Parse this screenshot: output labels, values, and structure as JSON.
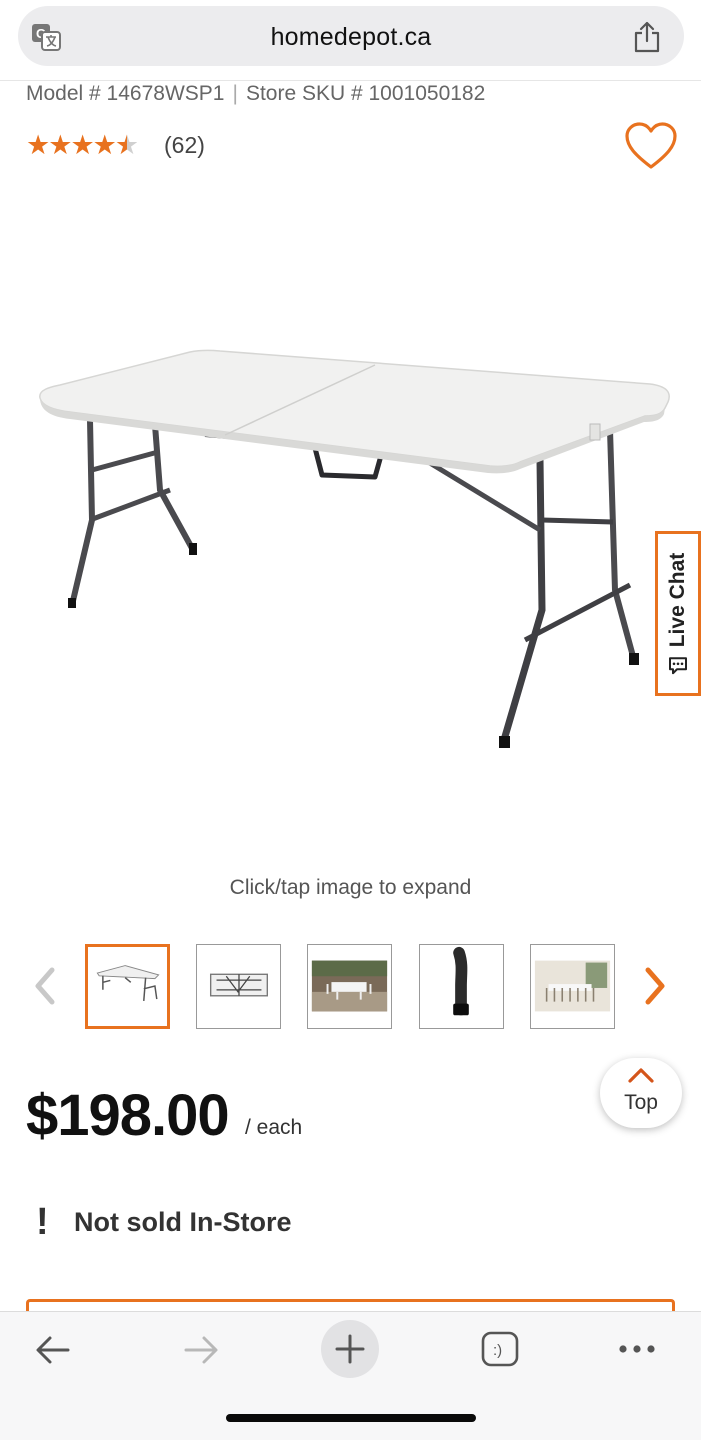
{
  "browser": {
    "domain": "homedepot.ca"
  },
  "product": {
    "model_label": "Model # 14678WSP1",
    "sku_label": "Store SKU # 1001050182",
    "rating": 4.5,
    "review_count": "(62)",
    "expand_hint": "Click/tap image to expand",
    "price": "$198.00",
    "price_unit": "/ each",
    "availability": "Not sold In-Store",
    "availability_icon": "!"
  },
  "live_chat": {
    "label": "Live Chat"
  },
  "back_to_top": {
    "label": "Top"
  },
  "thumbnails": [
    {
      "name": "folded-table-front",
      "active": true
    },
    {
      "name": "folded-table-closed",
      "active": false
    },
    {
      "name": "table-outdoor-setting",
      "active": false
    },
    {
      "name": "table-leg-detail",
      "active": false
    },
    {
      "name": "table-room-setting",
      "active": false
    }
  ],
  "colors": {
    "accent": "#e8721f",
    "text": "#333333"
  }
}
